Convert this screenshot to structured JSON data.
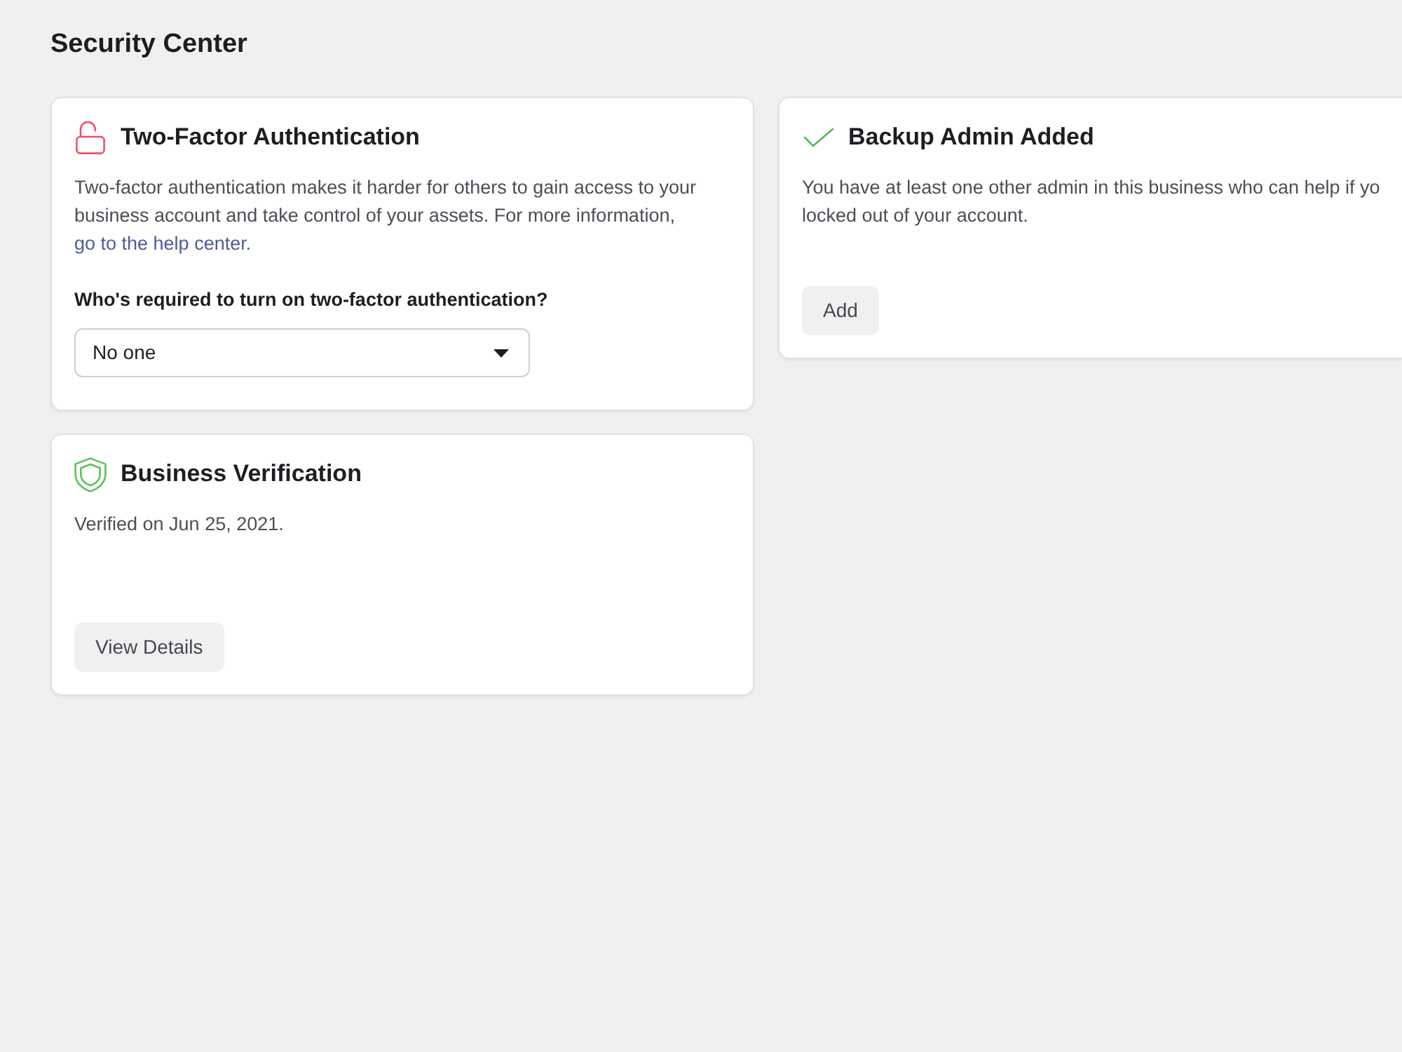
{
  "page": {
    "title": "Security Center"
  },
  "left_column": [
    {
      "kind": "alert",
      "title": "Two-Factor Authentication",
      "description": "Two-factor authentication makes it harder for others to gain access to your business account and take control of your assets. For more information,",
      "link": "go to the help center.",
      "question": "Who's required to turn on two-factor authentication?",
      "dropdown": {
        "value": "No one"
      }
    },
    {
      "kind": "verified",
      "title": "Business Verification",
      "description_lines": [
        "Verified on Jun 25, 2021."
      ],
      "button": "View Details"
    }
  ],
  "right_column": [
    {
      "kind": "success",
      "title": "Backup Admin Added",
      "description_lines": [
        "You have at least one other admin in this business who can help if yo",
        "locked out of your account."
      ],
      "button": "Add"
    }
  ]
}
